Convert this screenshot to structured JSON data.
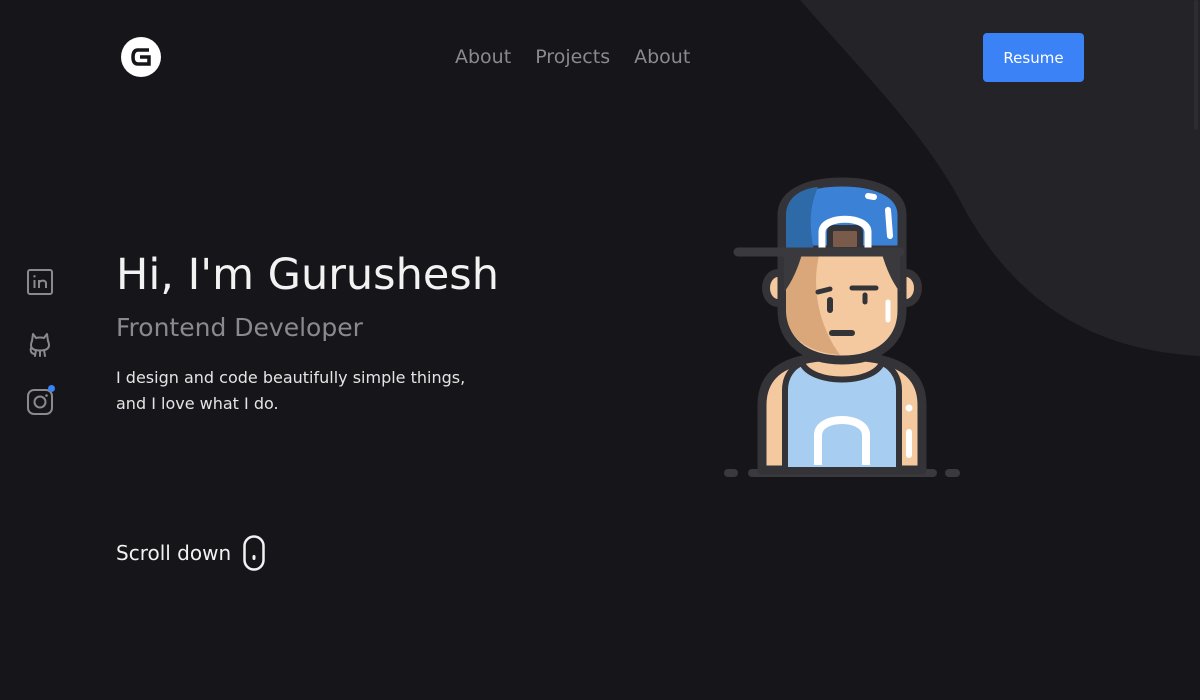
{
  "header": {
    "logo_icon": "g-letter-logo-icon",
    "nav": [
      {
        "label": "About"
      },
      {
        "label": "Projects"
      },
      {
        "label": "About"
      }
    ],
    "resume_label": "Resume"
  },
  "social": [
    {
      "icon": "linkedin-icon"
    },
    {
      "icon": "github-icon"
    },
    {
      "icon": "instagram-icon",
      "has_notification": true
    }
  ],
  "hero": {
    "title": "Hi, I'm Gurushesh",
    "role": "Frontend Developer",
    "description_line1": "I design and code beautifully simple things,",
    "description_line2": "and I love what I do.",
    "scroll_label": "Scroll down",
    "scroll_icon": "mouse-scroll-icon"
  },
  "colors": {
    "background": "#16161a",
    "blob": "#232328",
    "accent": "#3b82f6",
    "nav_text": "#8a8a8e",
    "heading_text": "#f2f2f2"
  }
}
